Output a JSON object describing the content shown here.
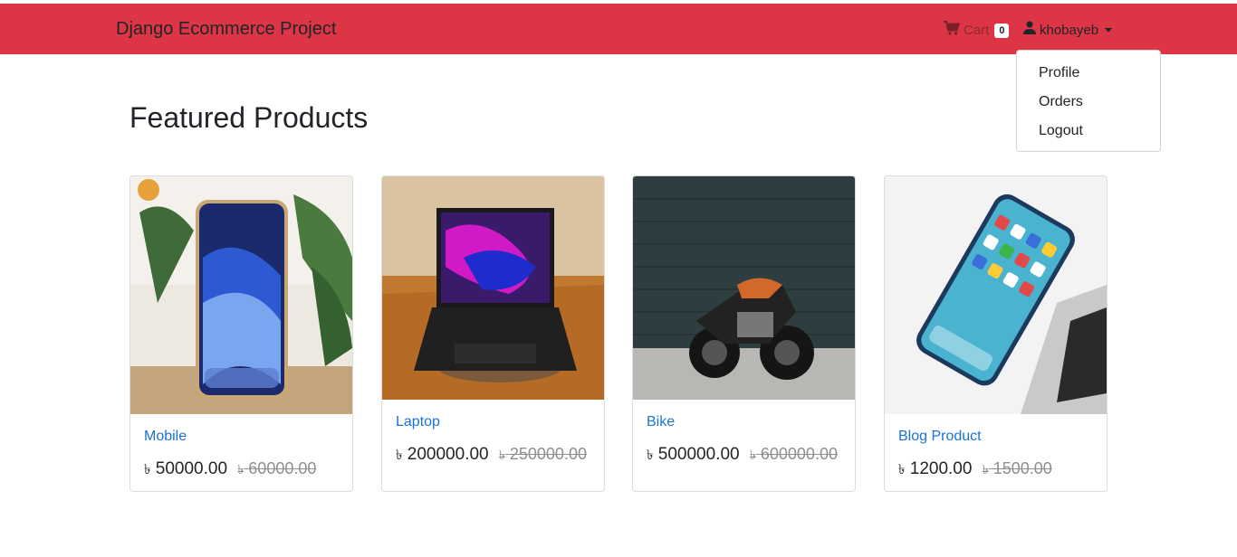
{
  "navbar": {
    "brand": "Django Ecommerce Project",
    "cart_label": "Cart",
    "cart_count": "0",
    "username": "khobayeb",
    "bg_color": "#dc3545"
  },
  "user_menu": {
    "items": [
      "Profile",
      "Orders",
      "Logout"
    ]
  },
  "main": {
    "title": "Featured Products"
  },
  "products": [
    {
      "name": "Mobile",
      "currency": "৳",
      "price": "50000.00",
      "old_price": "60000.00"
    },
    {
      "name": "Laptop",
      "currency": "৳",
      "price": "200000.00",
      "old_price": "250000.00"
    },
    {
      "name": "Bike",
      "currency": "৳",
      "price": "500000.00",
      "old_price": "600000.00"
    },
    {
      "name": "Blog Product",
      "currency": "৳",
      "price": "1200.00",
      "old_price": "1500.00"
    }
  ],
  "icons": {
    "cart": "shopping-cart-icon",
    "user": "user-icon",
    "dropdown": "caret-down-icon"
  }
}
